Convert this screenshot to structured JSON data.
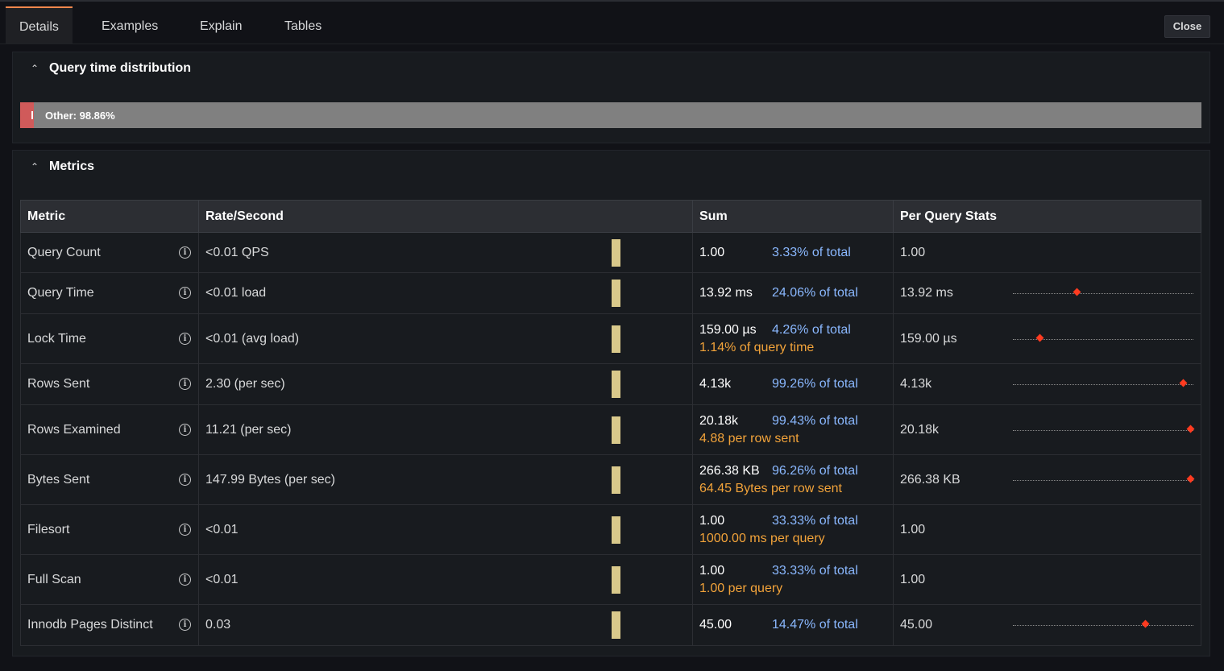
{
  "tabs": [
    "Details",
    "Examples",
    "Explain",
    "Tables"
  ],
  "close_label": "Close",
  "distribution": {
    "title": "Query time distribution",
    "bar_label": "Other: 98.86%",
    "red_segment_pct": 1.14,
    "colors": {
      "other": "#808080",
      "red": "#d05a5a"
    }
  },
  "metrics": {
    "title": "Metrics",
    "headers": [
      "Metric",
      "Rate/Second",
      "Sum",
      "Per Query Stats"
    ],
    "rows": [
      {
        "name": "Query Count",
        "rate": "<0.01 QPS",
        "sum": "1.00",
        "pct": "3.33% of total",
        "sub": "",
        "pq": "1.00",
        "marker": null
      },
      {
        "name": "Query Time",
        "rate": "<0.01 load",
        "sum": "13.92 ms",
        "pct": "24.06% of total",
        "sub": "",
        "pq": "13.92 ms",
        "marker": 0.35
      },
      {
        "name": "Lock Time",
        "rate": "<0.01 (avg load)",
        "sum": "159.00 µs",
        "pct": "4.26% of total",
        "sub": "1.14% of query time",
        "pq": "159.00 µs",
        "marker": 0.14
      },
      {
        "name": "Rows Sent",
        "rate": "2.30 (per sec)",
        "sum": "4.13k",
        "pct": "99.26% of total",
        "sub": "",
        "pq": "4.13k",
        "marker": 0.96
      },
      {
        "name": "Rows Examined",
        "rate": "11.21 (per sec)",
        "sum": "20.18k",
        "pct": "99.43% of total",
        "sub": "4.88 per row sent",
        "pq": "20.18k",
        "marker": 1.0
      },
      {
        "name": "Bytes Sent",
        "rate": "147.99 Bytes (per sec)",
        "sum": "266.38 KB",
        "pct": "96.26% of total",
        "sub": "64.45 Bytes per row sent",
        "pq": "266.38 KB",
        "marker": 1.0
      },
      {
        "name": "Filesort",
        "rate": "<0.01",
        "sum": "1.00",
        "pct": "33.33% of total",
        "sub": "1000.00 ms per query",
        "pq": "1.00",
        "marker": null
      },
      {
        "name": "Full Scan",
        "rate": "<0.01",
        "sum": "1.00",
        "pct": "33.33% of total",
        "sub": "1.00 per query",
        "pq": "1.00",
        "marker": null
      },
      {
        "name": "Innodb Pages Distinct",
        "rate": "0.03",
        "sum": "45.00",
        "pct": "14.47% of total",
        "sub": "",
        "pq": "45.00",
        "marker": 0.74
      }
    ]
  },
  "colors": {
    "pct": "#8ab8ff",
    "sub": "#f2a33a",
    "spark": "#d9c98b",
    "marker": "#ff3b20"
  }
}
